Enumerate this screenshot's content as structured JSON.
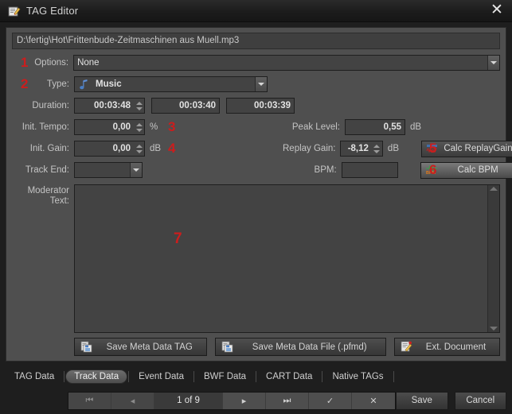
{
  "window": {
    "title": "TAG Editor",
    "title_icon": "tag-editor-icon",
    "close_label": "✕"
  },
  "file": {
    "path": "D:\\fertig\\Hot\\Frittenbude-Zeitmaschinen aus Muell.mp3"
  },
  "form": {
    "options": {
      "label": "Options:",
      "value": "None",
      "annotation": "1"
    },
    "type": {
      "label": "Type:",
      "value": "Music",
      "icon": "music-note-icon",
      "annotation": "2"
    },
    "duration": {
      "label": "Duration:",
      "value1": "00:03:48",
      "value2": "00:03:40",
      "value3": "00:03:39"
    },
    "init_tempo": {
      "label": "Init. Tempo:",
      "value": "0,00",
      "unit": "%",
      "annotation": "3"
    },
    "init_gain": {
      "label": "Init. Gain:",
      "value": "0,00",
      "unit": "dB",
      "annotation": "4"
    },
    "track_end": {
      "label": "Track End:",
      "value": ""
    },
    "peak_level": {
      "label": "Peak Level:",
      "value": "0,55",
      "unit": "dB"
    },
    "replay_gain": {
      "label": "Replay Gain:",
      "value": "-8,12",
      "unit": "dB",
      "annotation": "5"
    },
    "bpm": {
      "label": "BPM:",
      "value": "",
      "annotation": "6"
    },
    "calc_replaygain": {
      "label": "Calc ReplayGain",
      "icon": "waveform-icon"
    },
    "calc_bpm": {
      "label": "Calc BPM",
      "icon": "bpm-icon"
    },
    "moderator_text": {
      "label": "Moderator\nText:",
      "label_line1": "Moderator",
      "label_line2": "Text:",
      "value": "",
      "annotation": "7"
    }
  },
  "actions": {
    "save_meta_tag": {
      "label": "Save Meta Data TAG",
      "icon": "save-document-icon"
    },
    "save_meta_file": {
      "label": "Save Meta Data File (.pfmd)",
      "icon": "save-document-icon"
    },
    "ext_document": {
      "label": "Ext. Document",
      "icon": "edit-document-icon"
    }
  },
  "tabs": [
    {
      "label": "TAG Data",
      "active": false
    },
    {
      "label": "Track Data",
      "active": true
    },
    {
      "label": "Event Data",
      "active": false
    },
    {
      "label": "BWF Data",
      "active": false
    },
    {
      "label": "CART Data",
      "active": false
    },
    {
      "label": "Native TAGs",
      "active": false
    }
  ],
  "navigator": {
    "first": "⏮",
    "prev": "◂",
    "position": "1 of 9",
    "next": "▸",
    "last": "⏭",
    "accept": "✓",
    "cancel": "✕"
  },
  "footer": {
    "save": "Save",
    "cancel": "Cancel"
  },
  "colors": {
    "window_bg": "#1e1e1e",
    "panel_bg": "#4f4f4f",
    "field_bg": "#434343",
    "text": "#c4c4c4",
    "annotation_red": "#cc1d1d"
  }
}
